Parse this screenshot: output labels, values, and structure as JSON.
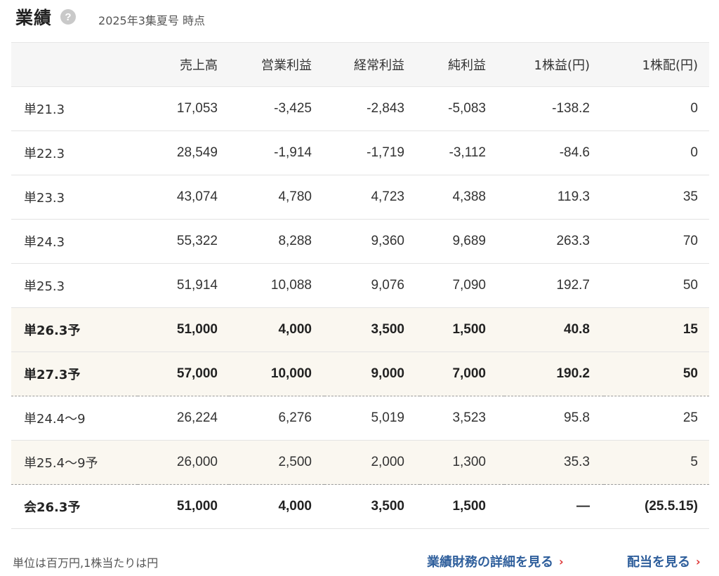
{
  "header": {
    "title": "業績",
    "help_icon_glyph": "?",
    "as_of": "2025年3集夏号 時点"
  },
  "table": {
    "columns": [
      "",
      "売上高",
      "営業利益",
      "経常利益",
      "純利益",
      "1株益(円)",
      "1株配(円)"
    ],
    "rows": [
      {
        "label": "単21.3",
        "values": [
          "17,053",
          "-3,425",
          "-2,843",
          "-5,083",
          "-138.2",
          "0"
        ]
      },
      {
        "label": "単22.3",
        "values": [
          "28,549",
          "-1,914",
          "-1,719",
          "-3,112",
          "-84.6",
          "0"
        ]
      },
      {
        "label": "単23.3",
        "values": [
          "43,074",
          "4,780",
          "4,723",
          "4,388",
          "119.3",
          "35"
        ]
      },
      {
        "label": "単24.3",
        "values": [
          "55,322",
          "8,288",
          "9,360",
          "9,689",
          "263.3",
          "70"
        ]
      },
      {
        "label": "単25.3",
        "values": [
          "51,914",
          "10,088",
          "9,076",
          "7,090",
          "192.7",
          "50"
        ]
      },
      {
        "label": "単26.3予",
        "values": [
          "51,000",
          "4,000",
          "3,500",
          "1,500",
          "40.8",
          "15"
        ]
      },
      {
        "label": "単27.3予",
        "values": [
          "57,000",
          "10,000",
          "9,000",
          "7,000",
          "190.2",
          "50"
        ]
      },
      {
        "label": "単24.4～9",
        "values": [
          "26,224",
          "6,276",
          "5,019",
          "3,523",
          "95.8",
          "25"
        ]
      },
      {
        "label": "単25.4～9予",
        "values": [
          "26,000",
          "2,500",
          "2,000",
          "1,300",
          "35.3",
          "5"
        ]
      },
      {
        "label": "会26.3予",
        "values": [
          "51,000",
          "4,000",
          "3,500",
          "1,500",
          "—",
          "(25.5.15)"
        ]
      }
    ]
  },
  "footer": {
    "unit_note": "単位は百万円,1株当たりは円",
    "details_link": "業績財務の詳細を見る",
    "dividend_link": "配当を見る",
    "chevron_glyph": "›"
  },
  "colors": {
    "link": "#2f5f9c",
    "chevron": "#d33333",
    "forecast_row_bg": "#faf7f0",
    "header_bg": "#f6f6f6"
  }
}
